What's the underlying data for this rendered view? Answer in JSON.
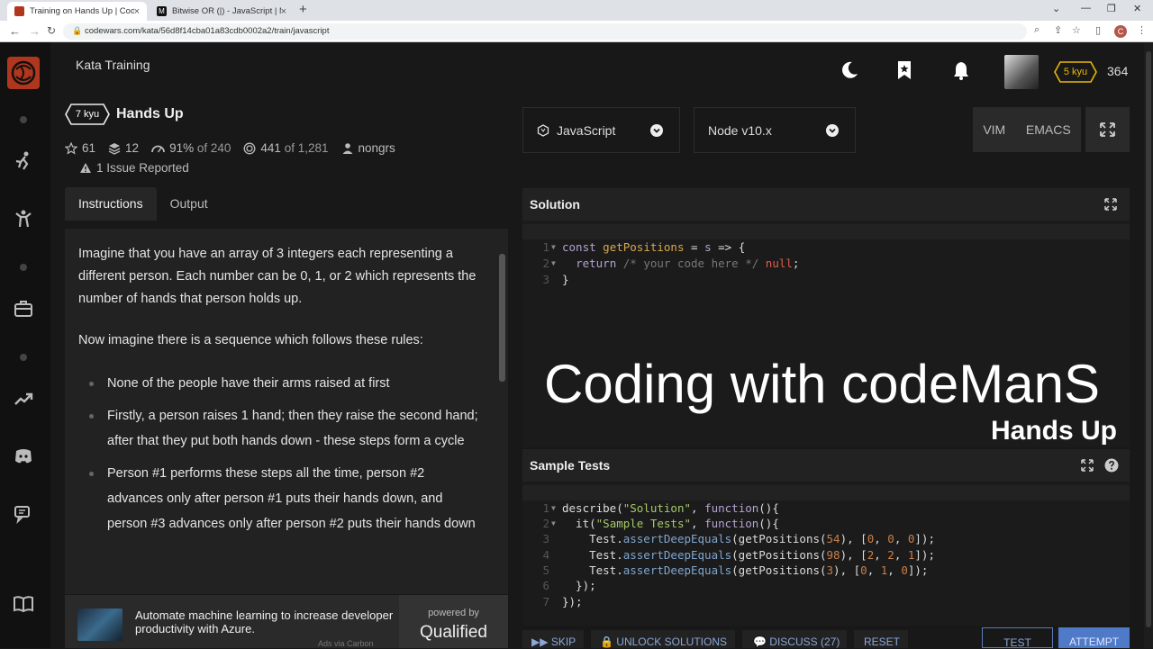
{
  "browser": {
    "tabs": [
      {
        "title": "Training on Hands Up | Codewars"
      },
      {
        "title": "Bitwise OR (|) - JavaScript | MDN"
      }
    ],
    "url": "codewars.com/kata/56d8f14cba01a83cdb0002a2/train/javascript",
    "profile_initial": "C"
  },
  "header": {
    "section_title": "Kata Training",
    "rank": "5 kyu",
    "honor": "364"
  },
  "kata": {
    "kyu": "7 kyu",
    "name": "Hands Up",
    "stars": "61",
    "collections": "12",
    "satisfaction_pct": "91%",
    "satisfaction_of": "of 240",
    "completed": "441",
    "completed_of": "of 1,281",
    "author": "nongrs",
    "issues": "1 Issue Reported"
  },
  "tabs": [
    "Instructions",
    "Output"
  ],
  "instructions": {
    "p1": "Imagine that you have an array of 3 integers each representing a different person. Each number can be 0, 1, or 2 which represents the number of hands that person holds up.",
    "p2": "Now imagine there is a sequence which follows these rules:",
    "bullets": [
      "None of the people have their arms raised at first",
      "Firstly, a person raises 1 hand; then they raise the second hand; after that they put both hands down - these steps form a cycle",
      "Person #1 performs these steps all the time, person #2 advances only after person #1 puts their hands down, and person #3 advances only after person #2 puts their hands down"
    ]
  },
  "ad": {
    "text": "Automate machine learning to increase developer productivity with Azure.",
    "via": "Ads via Carbon",
    "powered_by": "powered by",
    "brand": "Qualified"
  },
  "editor": {
    "language": "JavaScript",
    "runtime": "Node v10.x",
    "modes": [
      "VIM",
      "EMACS"
    ],
    "solution_title": "Solution",
    "tests_title": "Sample Tests",
    "solution_code": [
      "const getPositions = s => {",
      "  return /* your code here */ null;",
      "}"
    ],
    "test_code": [
      "describe(\"Solution\", function(){",
      "  it(\"Sample Tests\", function(){",
      "    Test.assertDeepEquals(getPositions(54), [0, 0, 0]);",
      "    Test.assertDeepEquals(getPositions(98), [2, 2, 1]);",
      "    Test.assertDeepEquals(getPositions(3), [0, 1, 0]);",
      "  });",
      "});"
    ]
  },
  "overlay": {
    "title": "Coding with codeManS",
    "subtitle": "Hands Up"
  },
  "toolbar": {
    "skip": "SKIP",
    "unlock": "UNLOCK SOLUTIONS",
    "discuss": "DISCUSS (27)",
    "reset": "RESET",
    "test": "TEST",
    "attempt": "ATTEMPT"
  },
  "colors": {
    "brand": "#b1361e",
    "rank_yellow": "#e9b80a",
    "attempt_blue": "#4f7ac8"
  }
}
